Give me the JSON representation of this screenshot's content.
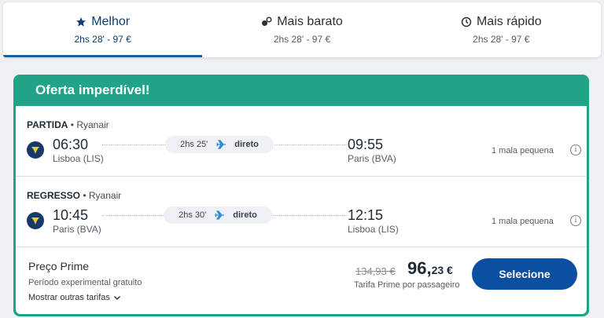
{
  "tabs": [
    {
      "label": "Melhor",
      "sub": "2hs 28' - 97 €",
      "icon": "star-icon"
    },
    {
      "label": "Mais barato",
      "sub": "2hs 28' - 97 €",
      "icon": "coins-icon"
    },
    {
      "label": "Mais rápido",
      "sub": "2hs 28' - 97 €",
      "icon": "clock-icon"
    }
  ],
  "offer": {
    "banner": "Oferta imperdível!"
  },
  "outbound": {
    "direction": "PARTIDA",
    "airline": "• Ryanair",
    "dep_time": "06:30",
    "dep_place": "Lisboa (LIS)",
    "duration": "2hs 25'",
    "stops": "direto",
    "arr_time": "09:55",
    "arr_place": "Paris (BVA)",
    "baggage": "1 mala pequena"
  },
  "return": {
    "direction": "REGRESSO",
    "airline": "• Ryanair",
    "dep_time": "10:45",
    "dep_place": "Paris (BVA)",
    "duration": "2hs 30'",
    "stops": "direto",
    "arr_time": "12:15",
    "arr_place": "Lisboa (LIS)",
    "baggage": "1 mala pequena"
  },
  "pricing": {
    "title": "Preço Prime",
    "trial": "Período experimental gratuito",
    "more_fares": "Mostrar outras tarifas",
    "old_price": "134,93 €",
    "price_int": "96,",
    "price_dec": "23 €",
    "per_passenger": "Tarifa Prime por passageiro",
    "select_label": "Selecione"
  },
  "colors": {
    "accent": "#0b4fa1",
    "offer": "#20a386",
    "logo": "#173a6b"
  }
}
